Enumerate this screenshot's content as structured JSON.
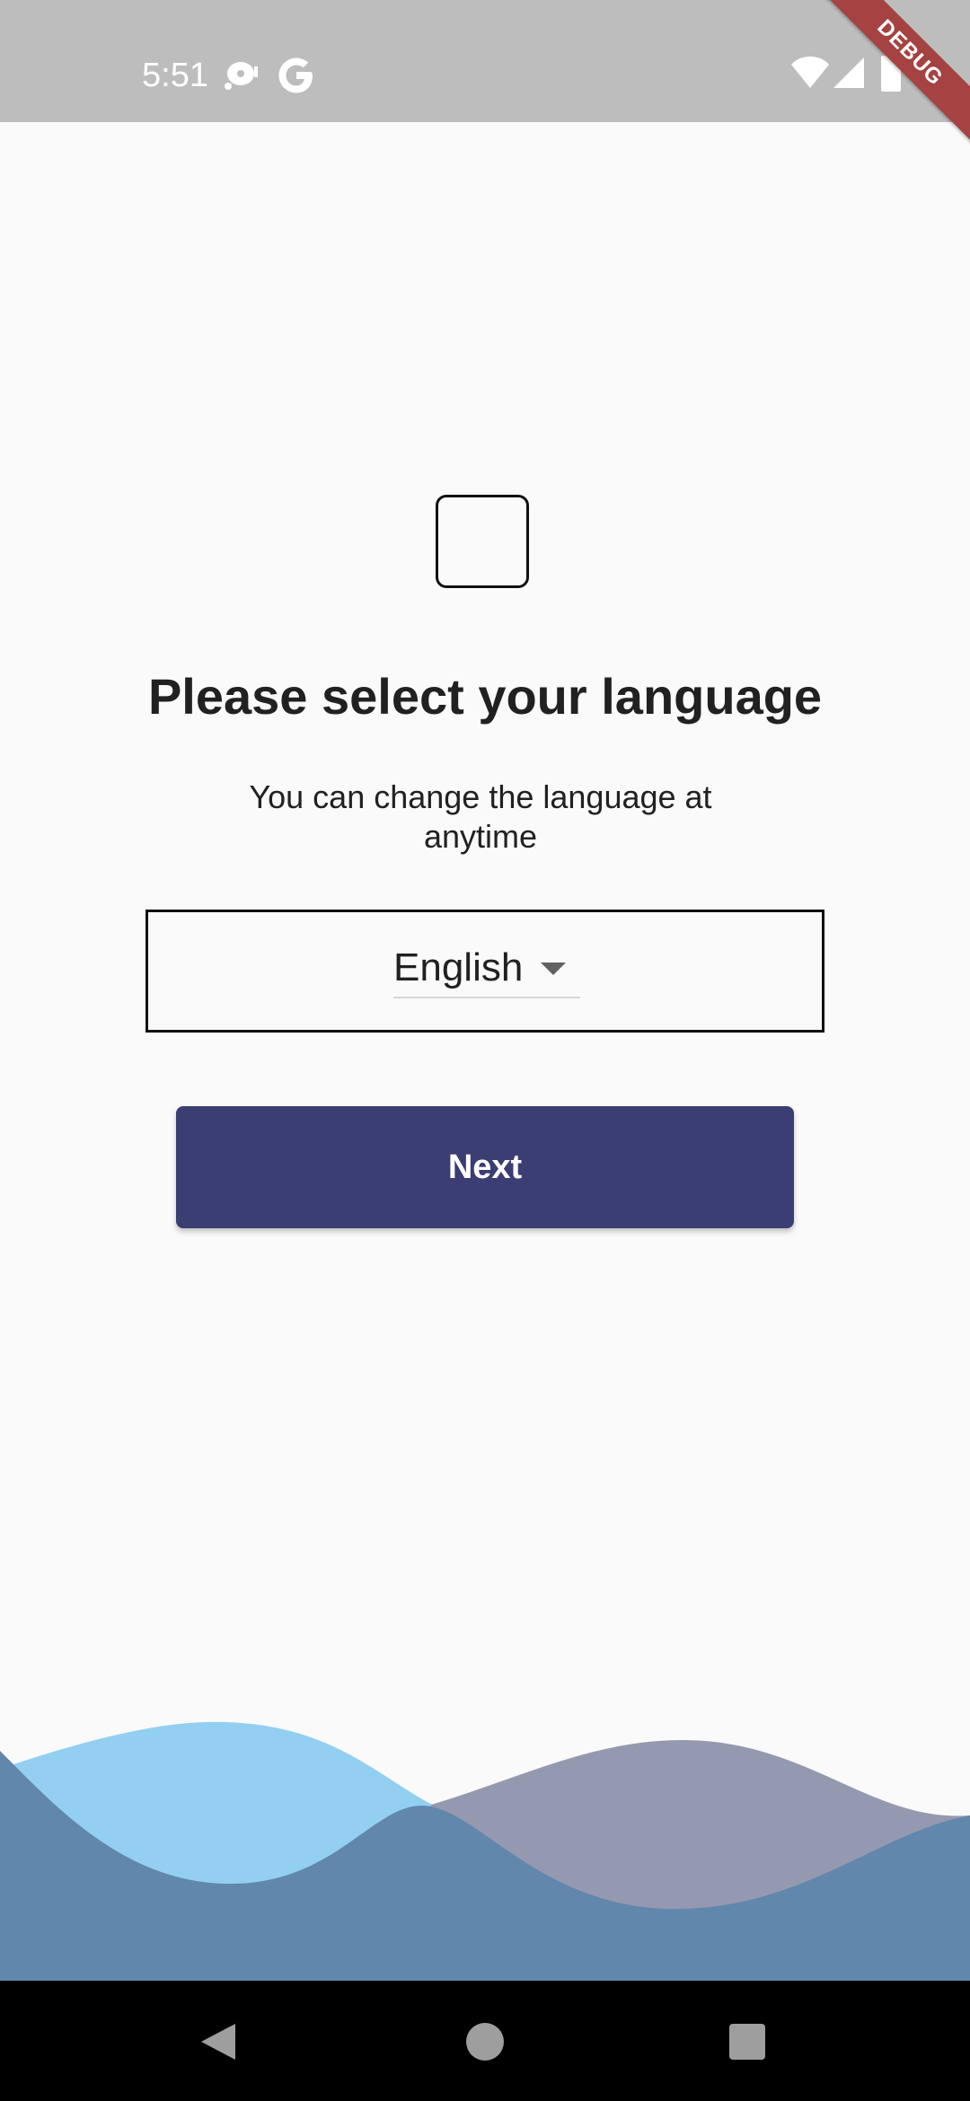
{
  "status_bar": {
    "time": "5:51",
    "icons": [
      "media-icon",
      "google-icon",
      "wifi-icon",
      "cell-signal-icon",
      "battery-icon"
    ]
  },
  "debug_banner": {
    "label": "DEBUG",
    "color": "#a54242"
  },
  "onboarding": {
    "logo": "app-logo-placeholder",
    "title": "Please select your language",
    "subtitle": "You can change the language at anytime",
    "language_select": {
      "selected": "English"
    },
    "next_label": "Next"
  },
  "colors": {
    "primary": "#3a3e72",
    "background": "#fafafa",
    "wave_light": "#93cff1",
    "wave_slate": "#9599b0",
    "wave_dark": "#6187ac"
  },
  "nav_bar": {
    "buttons": [
      "back-icon",
      "home-icon",
      "recents-icon"
    ]
  }
}
